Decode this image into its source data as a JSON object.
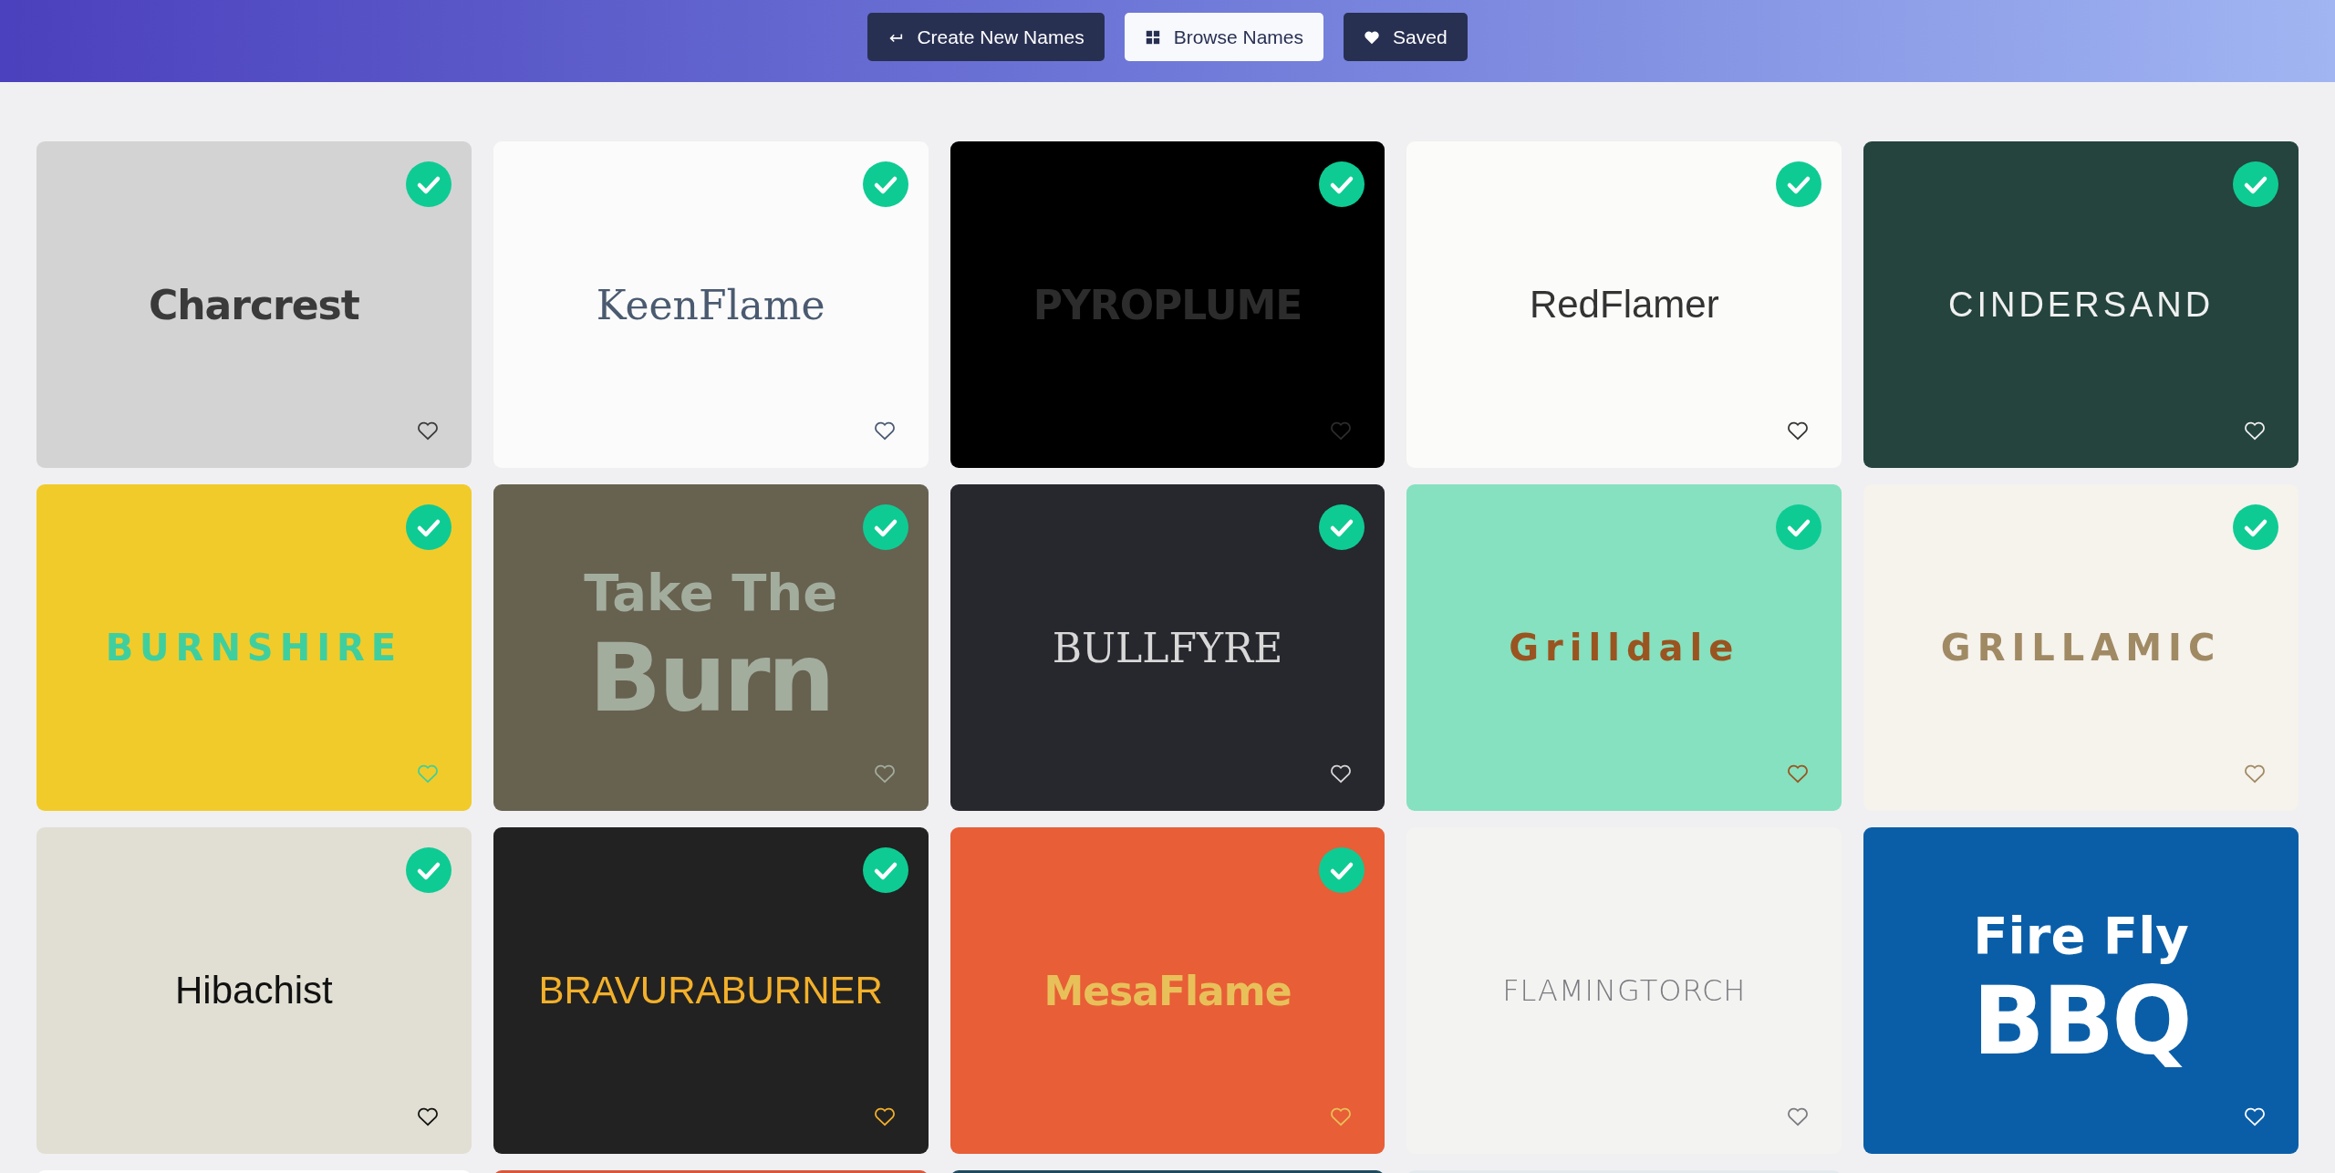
{
  "nav": [
    {
      "label": "Create New Names",
      "selected": false
    },
    {
      "label": "Browse Names",
      "selected": true
    },
    {
      "label": "Saved",
      "selected": false
    }
  ],
  "cards": [
    {
      "lines": [
        "Charcrest"
      ],
      "color": "#d3d3d3",
      "checked": true,
      "saved": false
    },
    {
      "lines": [
        "KeenFlame"
      ],
      "color": "#fbfbfb",
      "checked": true,
      "saved": false
    },
    {
      "lines": [
        "PYROPLUME"
      ],
      "color": "#000000",
      "checked": true,
      "saved": false
    },
    {
      "lines": [
        "RedFlamer"
      ],
      "color": "#fbfbf9",
      "checked": true,
      "saved": false
    },
    {
      "lines": [
        "CINDERSAND"
      ],
      "color": "#24443d",
      "checked": true,
      "saved": false
    },
    {
      "lines": [
        "BURNSHIRE"
      ],
      "color": "#f1cb2a",
      "checked": true,
      "saved": false
    },
    {
      "lines": [
        "Take The",
        "Burn"
      ],
      "color": "#676150",
      "checked": true,
      "saved": false
    },
    {
      "lines": [
        "BULLFYRE"
      ],
      "color": "#27272e",
      "checked": true,
      "saved": false
    },
    {
      "lines": [
        "Grilldale"
      ],
      "color": "#85e1bf",
      "checked": true,
      "saved": false
    },
    {
      "lines": [
        "GRILLAMIC"
      ],
      "color": "#f6f2ec",
      "checked": true,
      "saved": false
    },
    {
      "lines": [
        "Hibachist"
      ],
      "color": "#e1dfd3",
      "checked": true,
      "saved": false
    },
    {
      "lines": [
        "BRAVURABURNER"
      ],
      "color": "#222222",
      "checked": true,
      "saved": false
    },
    {
      "lines": [
        "MesaFlame"
      ],
      "color": "#e85e36",
      "checked": true,
      "saved": false
    },
    {
      "lines": [
        "FLAMINGTORCH"
      ],
      "color": "#f3f3f1",
      "checked": false,
      "saved": false
    },
    {
      "lines": [
        "Fire Fly",
        "BBQ"
      ],
      "color": "#0a5ea8",
      "checked": false,
      "saved": false
    }
  ],
  "more_cards": [
    {
      "color": "#ffffff"
    },
    {
      "color": "#d9573a"
    },
    {
      "color": "#1f4a5e"
    },
    {
      "color": "#e3eaee"
    }
  ]
}
